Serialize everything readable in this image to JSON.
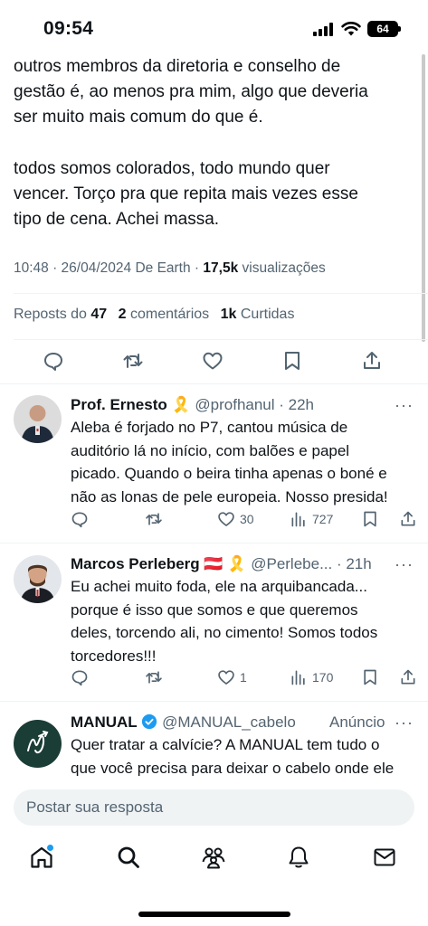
{
  "status": {
    "time": "09:54",
    "battery": "64"
  },
  "tweet": {
    "lines_p1": [
      "outros membros da diretoria e conselho de",
      "gestão é, ao menos pra mim, algo que deveria",
      "ser muito mais comum do que é."
    ],
    "lines_p2": [
      "todos somos colorados, todo mundo quer",
      "vencer. Torço pra que repita mais vezes esse",
      "tipo de cena. Achei massa."
    ],
    "timestamp": "10:48 · 26/04/2024 De Earth ·",
    "views_count": "17,5k",
    "views_label": "visualizações",
    "reposts_label": "Reposts do",
    "reposts_count": "47",
    "comments_count": "2",
    "comments_label": "comentários",
    "likes_count": "1k",
    "likes_label": "Curtidas"
  },
  "replies": [
    {
      "name": "Prof. Ernesto",
      "badge": "🎗️",
      "handle": "@profhanul · 22h",
      "more": "···",
      "lines": [
        "Aleba é forjado no P7, cantou música de",
        "auditório lá no início, com balões e papel",
        "picado. Quando o beira tinha apenas o boné e",
        "não as lonas de pele europeia. Nosso presida!"
      ],
      "likes": "30",
      "views": "727"
    },
    {
      "name": "Marcos Perleberg",
      "badge": "🇦🇹 🎗️",
      "handle": "@Perlebe... · 21h",
      "more": "···",
      "lines": [
        "Eu achei muito foda, ele na arquibancada...",
        "porque é isso que somos e que queremos",
        "deles, torcendo ali, no cimento! Somos todos",
        "torcedores!!!"
      ],
      "likes": "1",
      "views": "170"
    }
  ],
  "ad": {
    "name": "MANUAL",
    "handle": "@MANUAL_cabelo",
    "label": "Anúncio",
    "more": "···",
    "lines": [
      "Quer tratar a calvície? A MANUAL tem tudo o",
      "que você precisa para deixar o cabelo onde ele"
    ]
  },
  "reply_placeholder": "Postar sua resposta",
  "icons": {
    "actions": [
      "reply-icon",
      "repost-icon",
      "like-icon",
      "bookmark-icon",
      "share-icon"
    ],
    "nav": [
      "home-icon",
      "search-icon",
      "communities-icon",
      "notifications-icon",
      "messages-icon"
    ]
  },
  "colors": {
    "accent": "#1d9bf0",
    "text": "#0f1419",
    "secondary": "#536471",
    "verified": "#1d9bf0",
    "ad_avatar": "#1a3d36"
  }
}
